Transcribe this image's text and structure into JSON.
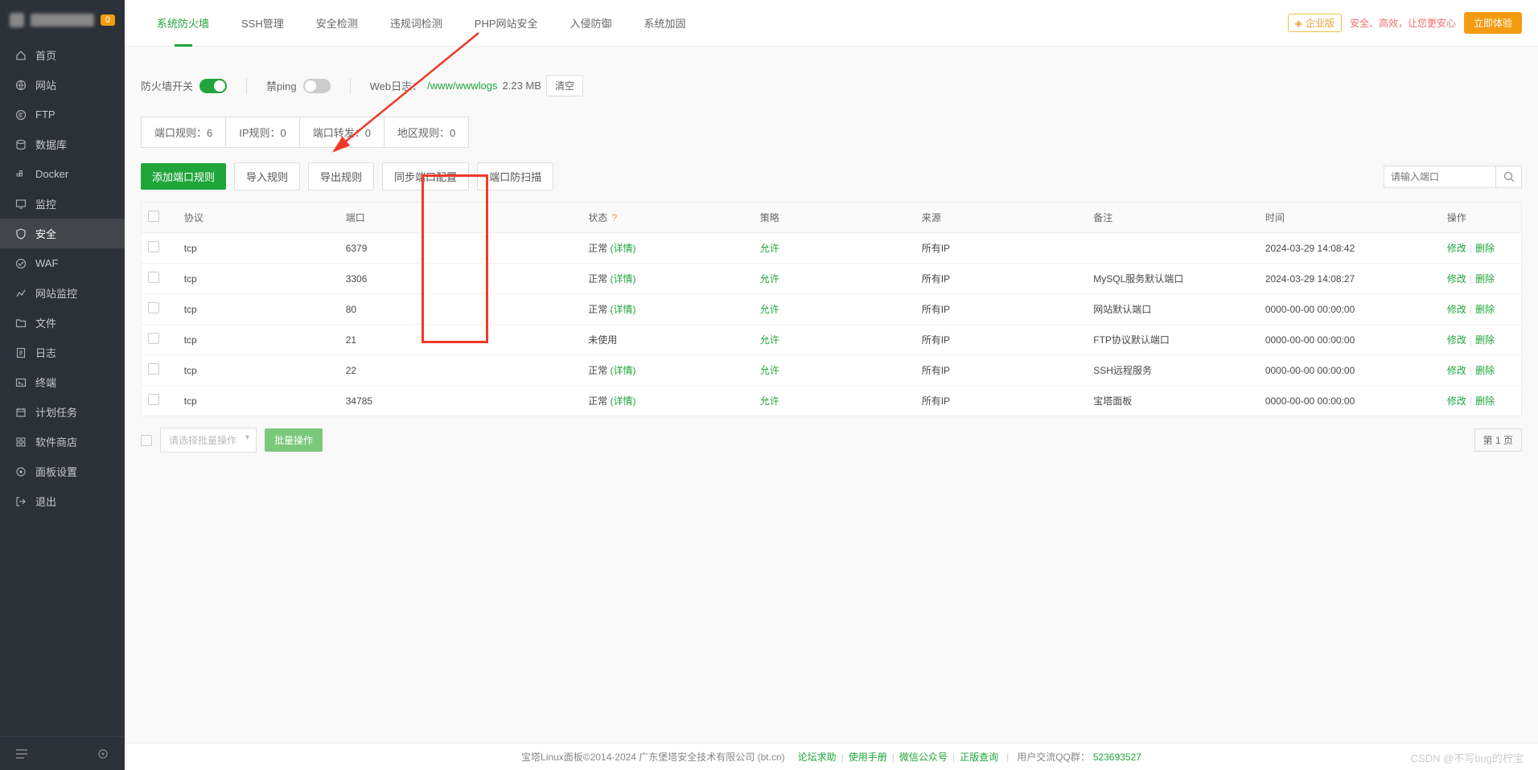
{
  "header": {
    "badge": "0"
  },
  "sidebar": {
    "items": [
      {
        "label": "首页",
        "icon": "home"
      },
      {
        "label": "网站",
        "icon": "globe"
      },
      {
        "label": "FTP",
        "icon": "ftp"
      },
      {
        "label": "数据库",
        "icon": "database"
      },
      {
        "label": "Docker",
        "icon": "docker"
      },
      {
        "label": "监控",
        "icon": "monitor"
      },
      {
        "label": "安全",
        "icon": "shield"
      },
      {
        "label": "WAF",
        "icon": "waf"
      },
      {
        "label": "网站监控",
        "icon": "sitemon"
      },
      {
        "label": "文件",
        "icon": "folder"
      },
      {
        "label": "日志",
        "icon": "log"
      },
      {
        "label": "终端",
        "icon": "terminal"
      },
      {
        "label": "计划任务",
        "icon": "task"
      },
      {
        "label": "软件商店",
        "icon": "store"
      },
      {
        "label": "面板设置",
        "icon": "settings"
      },
      {
        "label": "退出",
        "icon": "exit"
      }
    ]
  },
  "topTabs": {
    "items": [
      {
        "label": "系统防火墙"
      },
      {
        "label": "SSH管理"
      },
      {
        "label": "安全检测"
      },
      {
        "label": "违规词检测"
      },
      {
        "label": "PHP网站安全"
      },
      {
        "label": "入侵防御"
      },
      {
        "label": "系统加固"
      }
    ],
    "enterprise_tag": "企业版",
    "slogan": "安全、高效，让您更安心",
    "cta": "立即体验"
  },
  "toolbar": {
    "firewall_label": "防火墙开关",
    "ping_label": "禁ping",
    "weblog_label": "Web日志：",
    "weblog_path": "/www/wwwlogs",
    "weblog_size": "2.23 MB",
    "clear_btn": "清空"
  },
  "subTabs": {
    "items": [
      {
        "label": "端口规则：",
        "count": "6"
      },
      {
        "label": "IP规则：",
        "count": "0"
      },
      {
        "label": "端口转发：",
        "count": "0"
      },
      {
        "label": "地区规则：",
        "count": "0"
      }
    ]
  },
  "actions": {
    "add_rule": "添加端口规则",
    "import": "导入规则",
    "export": "导出规则",
    "sync": "同步端口配置",
    "scan": "端口防扫描",
    "search_placeholder": "请输入端口"
  },
  "table": {
    "headers": {
      "proto": "协议",
      "port": "端口",
      "status": "状态",
      "policy": "策略",
      "source": "来源",
      "remark": "备注",
      "time": "时间",
      "op": "操作"
    },
    "status_normal": "正常",
    "status_detail": "(详情)",
    "status_unused": "未使用",
    "policy_allow": "允许",
    "source_all": "所有IP",
    "op_edit": "修改",
    "op_delete": "删除",
    "rows": [
      {
        "proto": "tcp",
        "port": "6379",
        "status": "normal",
        "remark": "",
        "time": "2024-03-29 14:08:42"
      },
      {
        "proto": "tcp",
        "port": "3306",
        "status": "normal",
        "remark": "MySQL服务默认端口",
        "time": "2024-03-29 14:08:27"
      },
      {
        "proto": "tcp",
        "port": "80",
        "status": "normal",
        "remark": "网站默认端口",
        "time": "0000-00-00 00:00:00"
      },
      {
        "proto": "tcp",
        "port": "21",
        "status": "unused",
        "remark": "FTP协议默认端口",
        "time": "0000-00-00 00:00:00"
      },
      {
        "proto": "tcp",
        "port": "22",
        "status": "normal",
        "remark": "SSH远程服务",
        "time": "0000-00-00 00:00:00"
      },
      {
        "proto": "tcp",
        "port": "34785",
        "status": "normal",
        "remark": "宝塔面板",
        "time": "0000-00-00 00:00:00"
      }
    ]
  },
  "bottom": {
    "select_placeholder": "请选择批量操作",
    "batch_btn": "批量操作",
    "pager": "第 1 页"
  },
  "footer": {
    "copyright": "宝塔Linux面板©2014-2024 广东堡塔安全技术有限公司 (bt.cn)",
    "links": [
      "论坛求助",
      "使用手册",
      "微信公众号",
      "正版查询"
    ],
    "qq_label": "用户交流QQ群：",
    "qq": "523693527"
  },
  "watermark": "CSDN @不写bug的柠宝"
}
